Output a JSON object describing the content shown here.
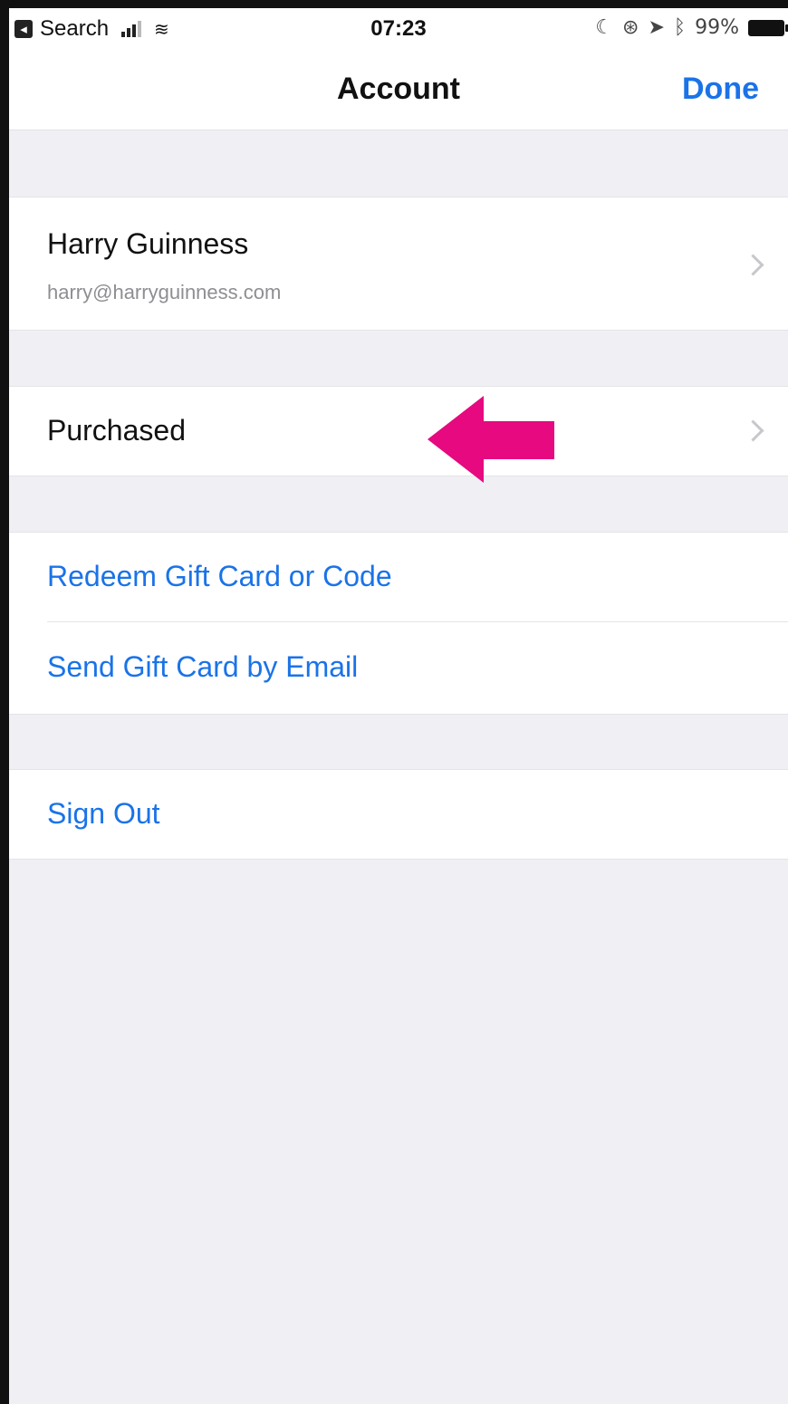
{
  "status_bar": {
    "back_app": "Search",
    "time": "07:23",
    "battery": "99%"
  },
  "nav": {
    "title": "Account",
    "done_label": "Done"
  },
  "account": {
    "name": "Harry Guinness",
    "email": "harry@harryguinness.com"
  },
  "purchased": {
    "label": "Purchased"
  },
  "gift": {
    "redeem_label": "Redeem Gift Card or Code",
    "send_label": "Send Gift Card by Email"
  },
  "sign_out": {
    "label": "Sign Out"
  },
  "colors": {
    "accent": "#1a73e8",
    "annotation_arrow": "#e6097f",
    "background": "#efeff4"
  },
  "icons": [
    "back-app-icon",
    "signal-icon",
    "wifi-icon",
    "battery-icon",
    "chevron-icon",
    "annotation-arrow"
  ]
}
